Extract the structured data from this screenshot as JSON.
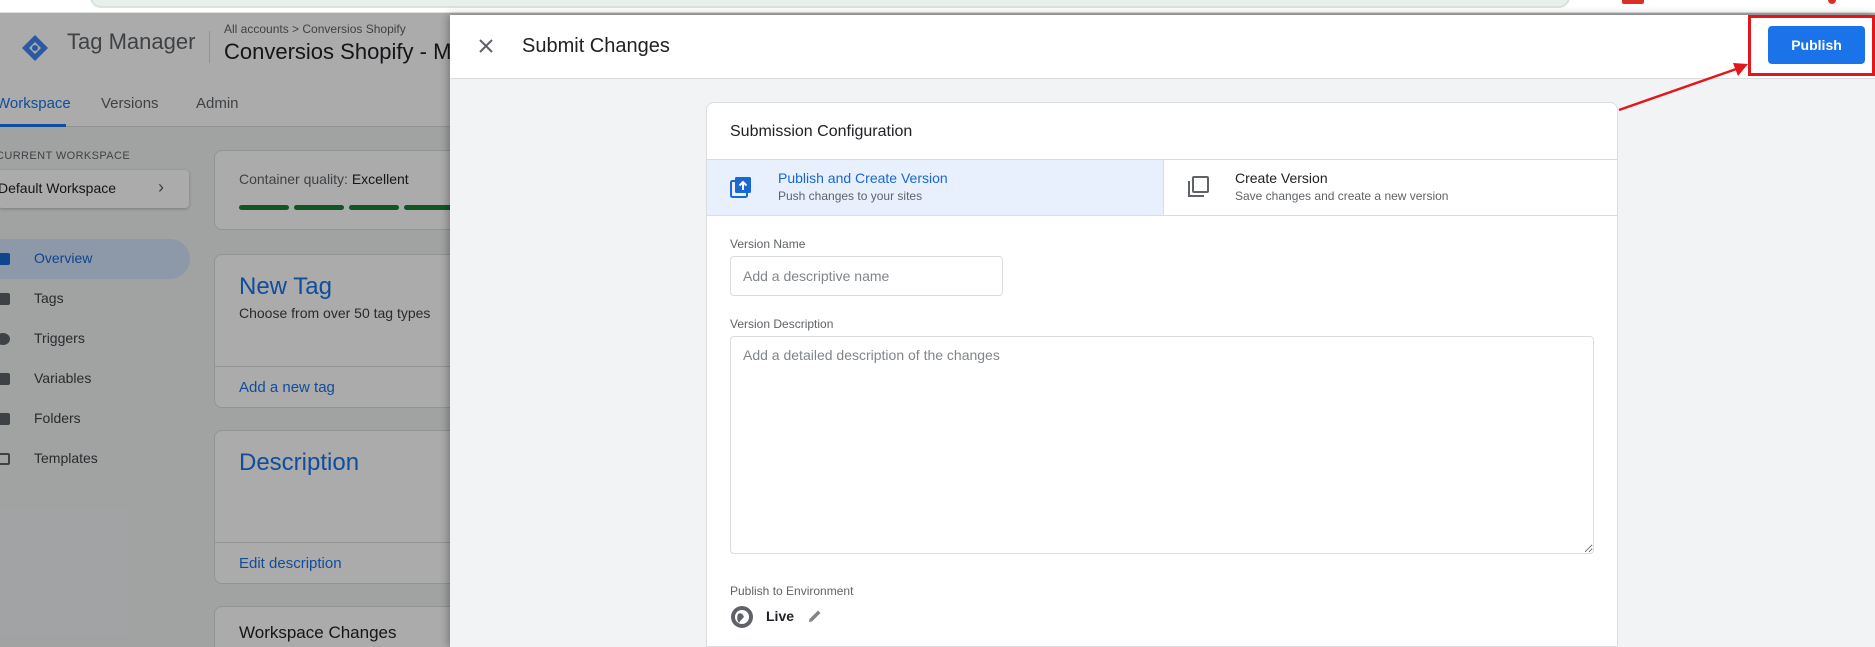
{
  "app": {
    "name": "Tag Manager",
    "breadcrumb": "All accounts > Conversios Shopify",
    "container_name": "Conversios Shopify - M"
  },
  "tabs": [
    {
      "label": "Workspace",
      "active": true
    },
    {
      "label": "Versions",
      "active": false
    },
    {
      "label": "Admin",
      "active": false
    }
  ],
  "sidebar": {
    "current_workspace_label": "CURRENT WORKSPACE",
    "workspace_name": "Default Workspace",
    "items": [
      {
        "label": "Overview",
        "icon": "overview-icon",
        "active": true
      },
      {
        "label": "Tags",
        "icon": "tag-icon",
        "active": false
      },
      {
        "label": "Triggers",
        "icon": "trigger-icon",
        "active": false
      },
      {
        "label": "Variables",
        "icon": "variable-icon",
        "active": false
      },
      {
        "label": "Folders",
        "icon": "folder-icon",
        "active": false
      },
      {
        "label": "Templates",
        "icon": "template-icon",
        "active": false
      }
    ]
  },
  "overview": {
    "quality_label": "Container quality:",
    "quality_value": "Excellent",
    "new_tag": {
      "title": "New Tag",
      "subtitle": "Choose from over 50 tag types",
      "link": "Add a new tag"
    },
    "description": {
      "title": "Description",
      "link": "Edit description"
    },
    "workspace_changes_title": "Workspace Changes"
  },
  "panel": {
    "title": "Submit Changes",
    "publish_label": "Publish",
    "config_title": "Submission Configuration",
    "options": [
      {
        "title": "Publish and Create Version",
        "subtitle": "Push changes to your sites",
        "selected": true
      },
      {
        "title": "Create Version",
        "subtitle": "Save changes and create a new version",
        "selected": false
      }
    ],
    "version_name_label": "Version Name",
    "version_name_placeholder": "Add a descriptive name",
    "version_desc_label": "Version Description",
    "version_desc_placeholder": "Add a detailed description of the changes",
    "env_label": "Publish to Environment",
    "env_name": "Live"
  },
  "colors": {
    "accent": "#1a73e8",
    "annotation": "#e3171b",
    "quality_bar": "#188038"
  }
}
